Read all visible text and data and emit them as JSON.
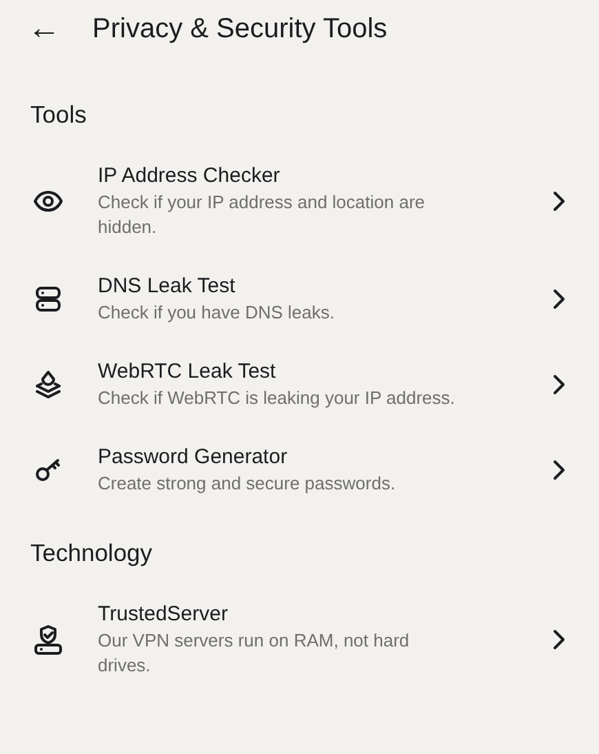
{
  "header": {
    "back": "←",
    "title": "Privacy & Security Tools"
  },
  "sections": [
    {
      "title": "Tools",
      "items": [
        {
          "title": "IP Address Checker",
          "description": "Check if your IP address and location are hidden."
        },
        {
          "title": "DNS Leak Test",
          "description": "Check if you have DNS leaks."
        },
        {
          "title": "WebRTC Leak Test",
          "description": "Check if WebRTC is leaking your IP address."
        },
        {
          "title": "Password Generator",
          "description": "Create strong and secure passwords."
        }
      ]
    },
    {
      "title": "Technology",
      "items": [
        {
          "title": "TrustedServer",
          "description": "Our VPN servers run on RAM, not hard drives."
        }
      ]
    }
  ]
}
